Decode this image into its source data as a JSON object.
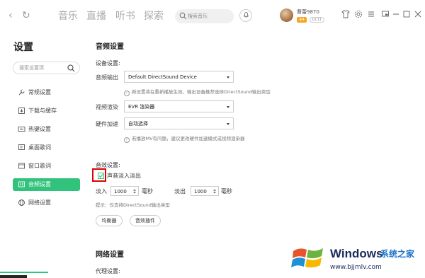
{
  "nav": {
    "back_icon": "chevron-left-icon",
    "refresh_icon": "refresh-icon",
    "tabs": [
      "音乐",
      "直播",
      "听书",
      "探索"
    ]
  },
  "search": {
    "placeholder": "搜索音乐"
  },
  "user": {
    "name": "曹蕾9870",
    "vip_badge": "♛4",
    "level": "LV.11"
  },
  "window_icons": [
    "tshirt-icon",
    "gear-icon",
    "menu-icon",
    "mini-player-icon",
    "minimize-icon",
    "maximize-icon",
    "close-icon"
  ],
  "sidebar": {
    "title": "设置",
    "search_placeholder": "搜索设置项",
    "items": [
      {
        "label": "常规设置",
        "icon": "wrench-icon"
      },
      {
        "label": "下载与缓存",
        "icon": "download-icon"
      },
      {
        "label": "热键设置",
        "icon": "keyboard-icon"
      },
      {
        "label": "桌面歌词",
        "icon": "desktop-lyrics-icon"
      },
      {
        "label": "窗口歌词",
        "icon": "window-lyrics-icon"
      },
      {
        "label": "音频设置",
        "icon": "audio-icon",
        "active": true
      },
      {
        "label": "网络设置",
        "icon": "network-icon"
      }
    ]
  },
  "audio": {
    "section_title": "音频设置",
    "device_title": "设备设置:",
    "output_label": "音频输出",
    "output_value": "Default DirectSound Device",
    "output_hint": "新设置将在重新播放生效，输出设备推荐选择DirectSound输出类型",
    "render_label": "视频渲染",
    "render_value": "EVR 渲染器",
    "hw_label": "硬件加速",
    "hw_value": "自动选择",
    "hw_hint": "若播放MV有问题，建议更改硬件加速模式或视频渲染器",
    "effects_title": "音效设置:",
    "fade_label": "声音淡入淡出",
    "fade_checked": true,
    "fade_in_label": "淡入",
    "fade_in_value": "1000",
    "fade_in_unit": "毫秒",
    "fade_out_label": "淡出",
    "fade_out_value": "1000",
    "fade_out_unit": "毫秒",
    "tip": "提示：仅支持DirectSound输出类型",
    "eq_button": "均衡器",
    "plugin_button": "音效插件"
  },
  "network": {
    "section_title": "网络设置",
    "proxy_title": "代理设置:"
  },
  "watermark": {
    "brand": "Windows",
    "cn": "系统之家",
    "url": "www.bjjmlv.com"
  },
  "colors": {
    "accent": "#31c27c",
    "highlight_box": "#e00000"
  }
}
